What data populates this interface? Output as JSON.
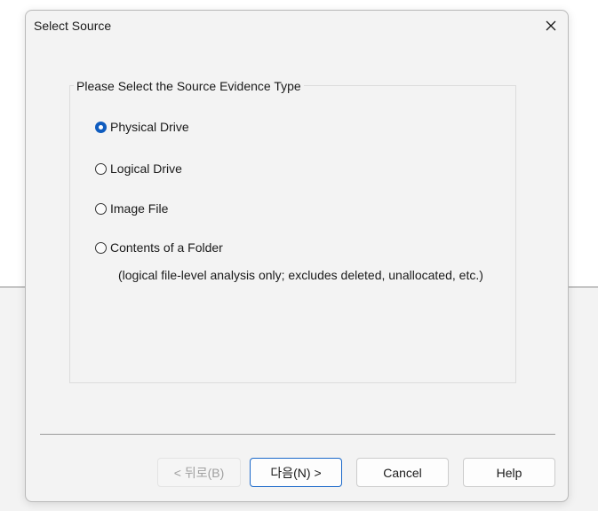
{
  "dialog": {
    "title": "Select Source",
    "close_icon": "close-icon"
  },
  "group": {
    "legend": "Please Select the Source Evidence Type",
    "options": [
      {
        "label": "Physical Drive",
        "checked": true
      },
      {
        "label": "Logical Drive",
        "checked": false
      },
      {
        "label": "Image File",
        "checked": false
      },
      {
        "label": "Contents of a Folder",
        "checked": false
      }
    ],
    "note": "(logical file-level analysis only; excludes deleted, unallocated, etc.)"
  },
  "buttons": {
    "back": "< 뒤로(B)",
    "next": "다음(N) >",
    "cancel": "Cancel",
    "help": "Help"
  },
  "colors": {
    "accent": "#0f5cbf",
    "dialog_bg": "#f3f3f3"
  }
}
